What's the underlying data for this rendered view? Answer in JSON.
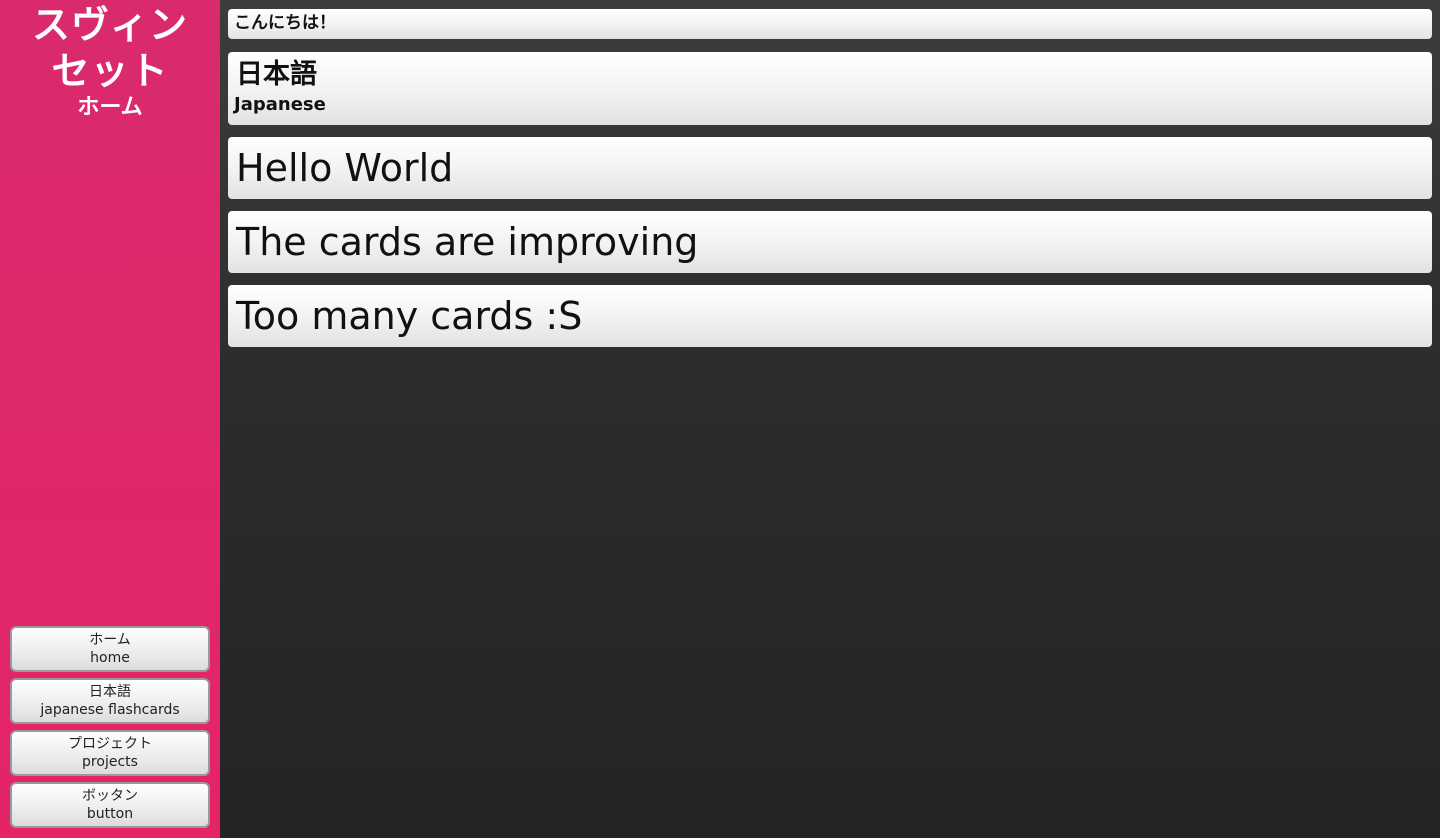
{
  "sidebar": {
    "brand": {
      "line1": "スヴィン",
      "line2": "セット",
      "subtitle": "ホーム"
    },
    "nav": [
      {
        "jp": "ホーム",
        "en": "home"
      },
      {
        "jp": "日本語",
        "en": "japanese flashcards"
      },
      {
        "jp": "プロジェクト",
        "en": "projects"
      },
      {
        "jp": "ボッタン",
        "en": "button"
      }
    ]
  },
  "cards": {
    "greeting": "こんにちは！",
    "japanese": {
      "title": "日本語",
      "subtitle": "Japanese"
    },
    "hello": "Hello World",
    "improving": "The cards are improving",
    "too_many": "Too many cards :S"
  },
  "colors": {
    "sidebar_accent": "#e52468",
    "background": "#2a2a2a",
    "card": "#f3f3f3"
  }
}
